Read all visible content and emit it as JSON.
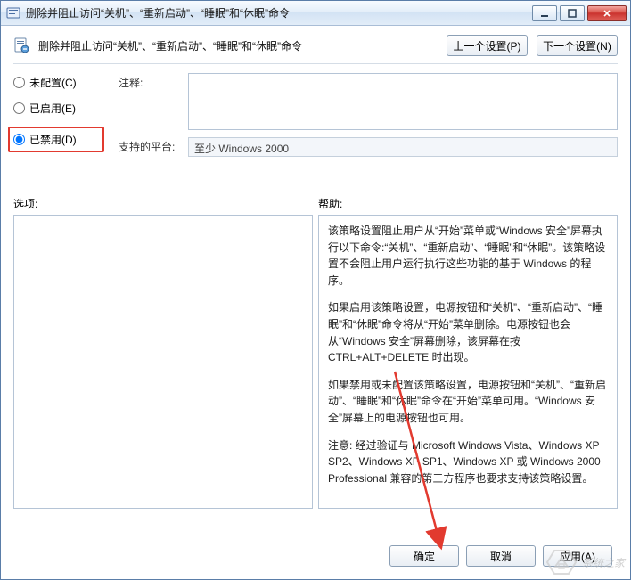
{
  "window": {
    "title": "删除并阻止访问“关机”、“重新启动”、“睡眠”和“休眠”命令"
  },
  "header": {
    "title": "删除并阻止访问“关机”、“重新启动”、“睡眠”和“休眠”命令",
    "prev_label": "上一个设置(P)",
    "next_label": "下一个设置(N)"
  },
  "radios": {
    "not_configured": "未配置(C)",
    "enabled": "已启用(E)",
    "disabled": "已禁用(D)"
  },
  "labels": {
    "comment": "注释:",
    "platform": "支持的平台:",
    "options": "选项:",
    "help": "帮助:"
  },
  "platform_value": "至少 Windows 2000",
  "help": {
    "p1": "该策略设置阻止用户从“开始”菜单或“Windows 安全”屏幕执行以下命令:“关机”、“重新启动”、“睡眠”和“休眠”。该策略设置不会阻止用户运行执行这些功能的基于 Windows 的程序。",
    "p2": "如果启用该策略设置，电源按钮和“关机”、“重新启动”、“睡眠”和“休眠”命令将从“开始”菜单删除。电源按钮也会从“Windows 安全”屏幕删除，该屏幕在按 CTRL+ALT+DELETE 时出现。",
    "p3": "如果禁用或未配置该策略设置，电源按钮和“关机”、“重新启动”、“睡眠”和“休眠”命令在“开始”菜单可用。“Windows 安全”屏幕上的电源按钮也可用。",
    "p4": "注意: 经过验证与 Microsoft Windows Vista、Windows XP SP2、Windows XP SP1、Windows XP 或 Windows 2000 Professional 兼容的第三方程序也要求支持该策略设置。"
  },
  "footer": {
    "ok": "确定",
    "cancel": "取消",
    "apply": "应用(A)"
  },
  "watermark": {
    "text": "系统之家"
  }
}
